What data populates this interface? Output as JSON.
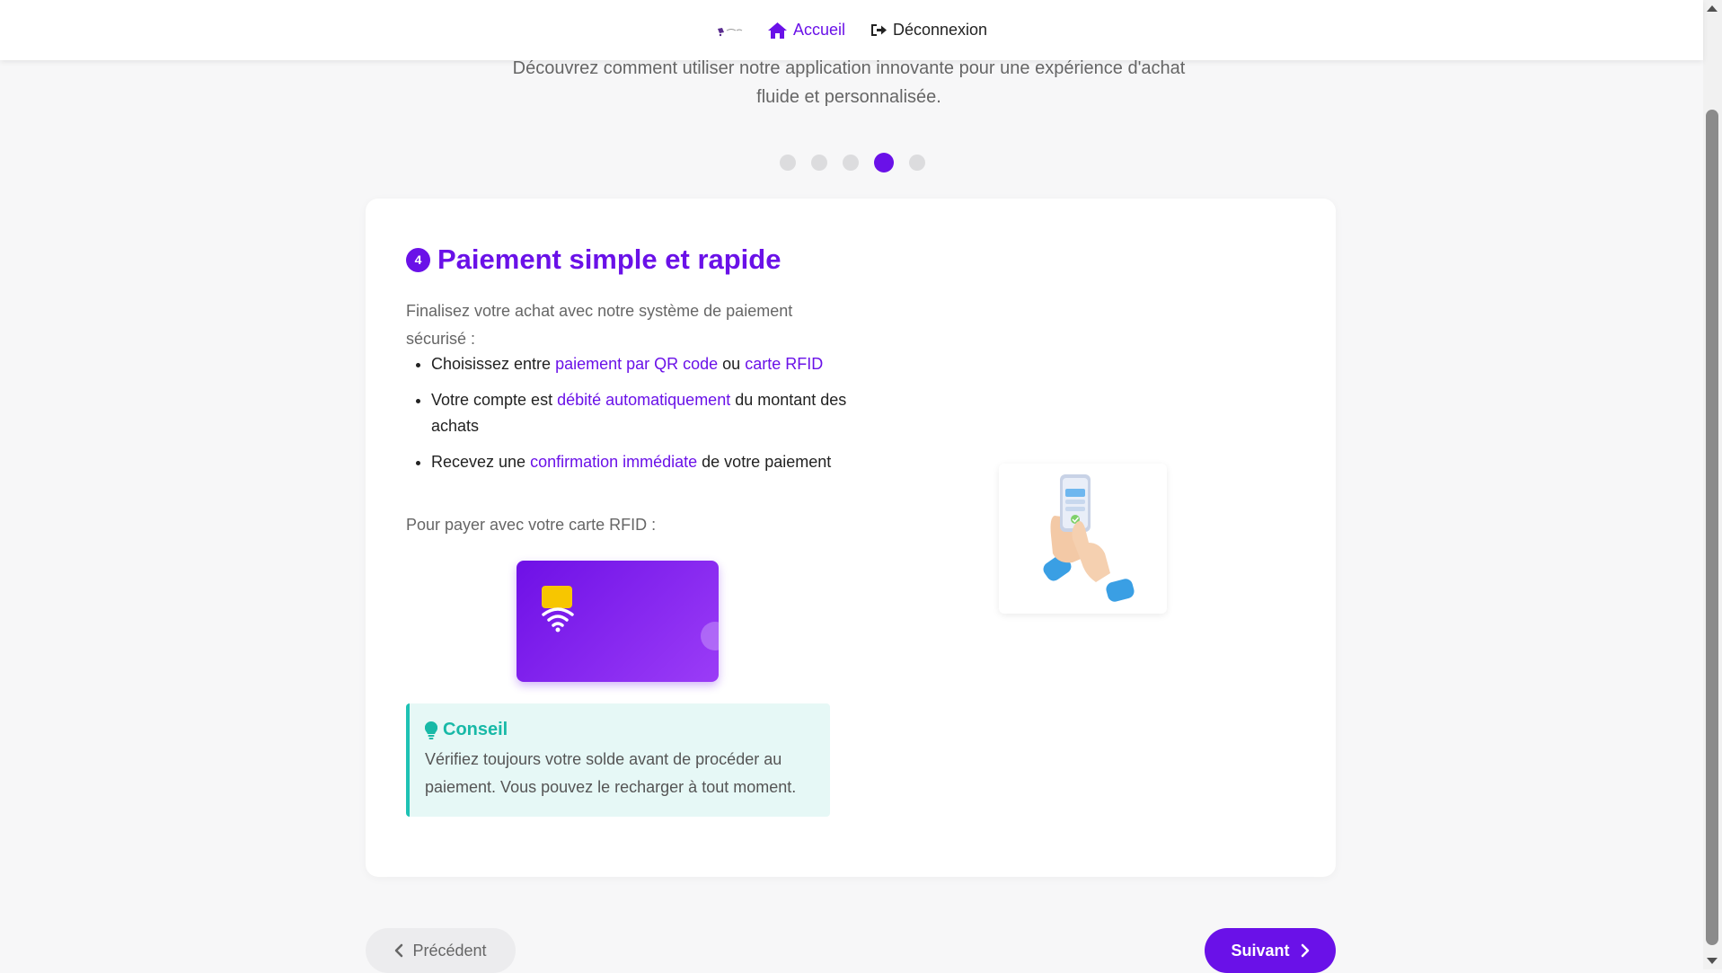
{
  "nav": {
    "home_label": "Accueil",
    "logout_label": "Déconnexion",
    "home_icon": "home-icon",
    "logout_icon": "logout-icon",
    "logo": "app-logo"
  },
  "intro": {
    "subtitle": "Découvrez comment utiliser notre application innovante pour une expérience d'achat fluide et personnalisée."
  },
  "carousel": {
    "dot_count": 5,
    "active_index": 4
  },
  "step": {
    "number": "4",
    "title": "Paiement simple et rapide",
    "description": "Finalisez votre achat avec notre système de paiement sécurisé :",
    "bullets": [
      {
        "before": "Choisissez entre ",
        "hl1": "paiement par QR code",
        "mid": " ou ",
        "hl2": "carte RFID",
        "after": ""
      },
      {
        "before": "Votre compte est ",
        "hl1": "débité automatiquement",
        "after": " du montant des achats"
      },
      {
        "before": "Recevez une ",
        "hl1": "confirmation immédiate",
        "after": " de votre paiement"
      }
    ],
    "rfid_label": "Pour payer avec votre carte RFID :"
  },
  "tip": {
    "title": "Conseil",
    "text": "Vérifiez toujours votre solde avant de procéder au paiement. Vous pouvez le recharger à tout moment.",
    "icon": "lightbulb-icon"
  },
  "buttons": {
    "prev_label": "Précédent",
    "next_label": "Suivant"
  },
  "colors": {
    "accent": "#6a11e8",
    "tip_accent": "#18b9a7",
    "chip": "#f7c600"
  }
}
